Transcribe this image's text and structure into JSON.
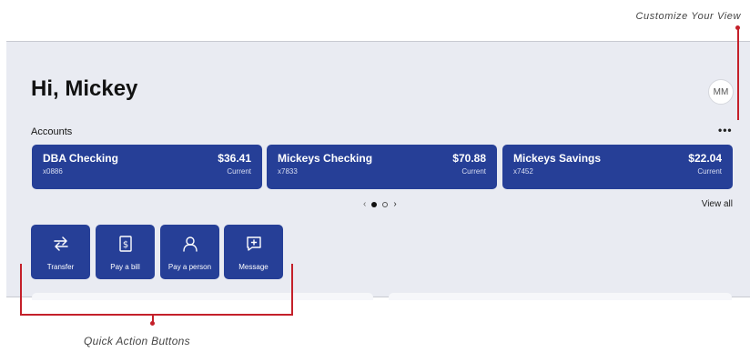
{
  "annotations": {
    "customize_view": "Customize Your View",
    "quick_actions": "Quick Action Buttons"
  },
  "header": {
    "greeting": "Hi, Mickey",
    "avatar_initials": "MM"
  },
  "accounts": {
    "label": "Accounts",
    "more": "•••",
    "view_all": "View all",
    "items": [
      {
        "name": "DBA Checking",
        "number": "x0886",
        "balance": "$36.41",
        "status": "Current"
      },
      {
        "name": "Mickeys Checking",
        "number": "x7833",
        "balance": "$70.88",
        "status": "Current"
      },
      {
        "name": "Mickeys Savings",
        "number": "x7452",
        "balance": "$22.04",
        "status": "Current"
      }
    ],
    "pager": {
      "prev": "‹",
      "next": "›"
    }
  },
  "quick_actions": [
    {
      "label": "Transfer",
      "icon": "transfer-icon"
    },
    {
      "label": "Pay a bill",
      "icon": "bill-icon"
    },
    {
      "label": "Pay a person",
      "icon": "person-icon"
    },
    {
      "label": "Message",
      "icon": "message-icon"
    }
  ],
  "colors": {
    "primary": "#263f97",
    "background": "#e9ebf2",
    "callout": "#c4202a"
  }
}
